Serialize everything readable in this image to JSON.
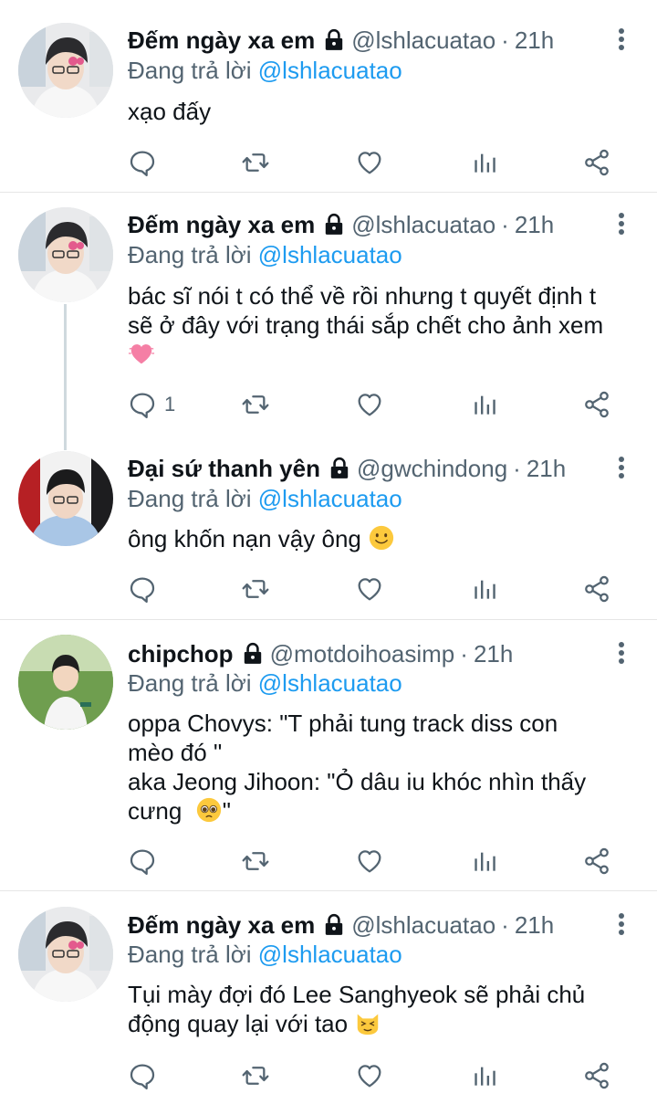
{
  "tweets": [
    {
      "name": "Đếm ngày xa em",
      "handle": "@lshlacuatao",
      "time": "21h",
      "reply_prefix": "Đang trả lời ",
      "reply_to": "@lshlacuatao",
      "text_lines": [
        "xạo đấy"
      ],
      "reply_count": "",
      "avatar": "avatar-user-1"
    },
    {
      "name": "Đếm ngày xa em",
      "handle": "@lshlacuatao",
      "time": "21h",
      "reply_prefix": "Đang trả lời ",
      "reply_to": "@lshlacuatao",
      "text_lines": [
        "bác sĩ nói t có thể về rồi nhưng t quyết định t",
        "sẽ ở đây với trạng thái sắp chết cho ảnh xem"
      ],
      "emoji": "heart-emoji",
      "reply_count": "1",
      "avatar": "avatar-user-1"
    },
    {
      "name": "Đại sứ thanh yên",
      "handle": "@gwchindong",
      "time": "21h",
      "reply_prefix": "Đang trả lời ",
      "reply_to": "@lshlacuatao",
      "text_lines": [
        "ông khốn nạn vậy ông"
      ],
      "emoji": "smile-emoji",
      "reply_count": "",
      "avatar": "avatar-user-2"
    },
    {
      "name": "chipchop",
      "handle": "@motdoihoasimp",
      "time": "21h",
      "reply_prefix": "Đang trả lời ",
      "reply_to": "@lshlacuatao",
      "text_lines": [
        "oppa Chovys: \"T phải tung track diss con",
        "mèo đó \"",
        "aka Jeong Jihoon: \"Ỏ dâu iu khóc nhìn thấy",
        "cưng"
      ],
      "line4_suffix": "\"",
      "emoji": "pleading-emoji",
      "reply_count": "",
      "avatar": "avatar-user-3"
    },
    {
      "name": "Đếm ngày xa em",
      "handle": "@lshlacuatao",
      "time": "21h",
      "reply_prefix": "Đang trả lời ",
      "reply_to": "@lshlacuatao",
      "text_lines": [
        "Tụi mày đợi đó Lee Sanghyeok sẽ phải chủ",
        "động quay lại với tao"
      ],
      "emoji": "cat-emoji",
      "reply_count": "",
      "avatar": "avatar-user-1"
    }
  ],
  "icons": [
    "reply-icon",
    "retweet-icon",
    "like-icon",
    "analytics-icon",
    "share-icon",
    "lock-icon",
    "more-icon"
  ],
  "colors": {
    "link": "#1d9bf0",
    "secondary": "#536471",
    "text": "#0f1419",
    "divider": "#e6e6e6"
  }
}
